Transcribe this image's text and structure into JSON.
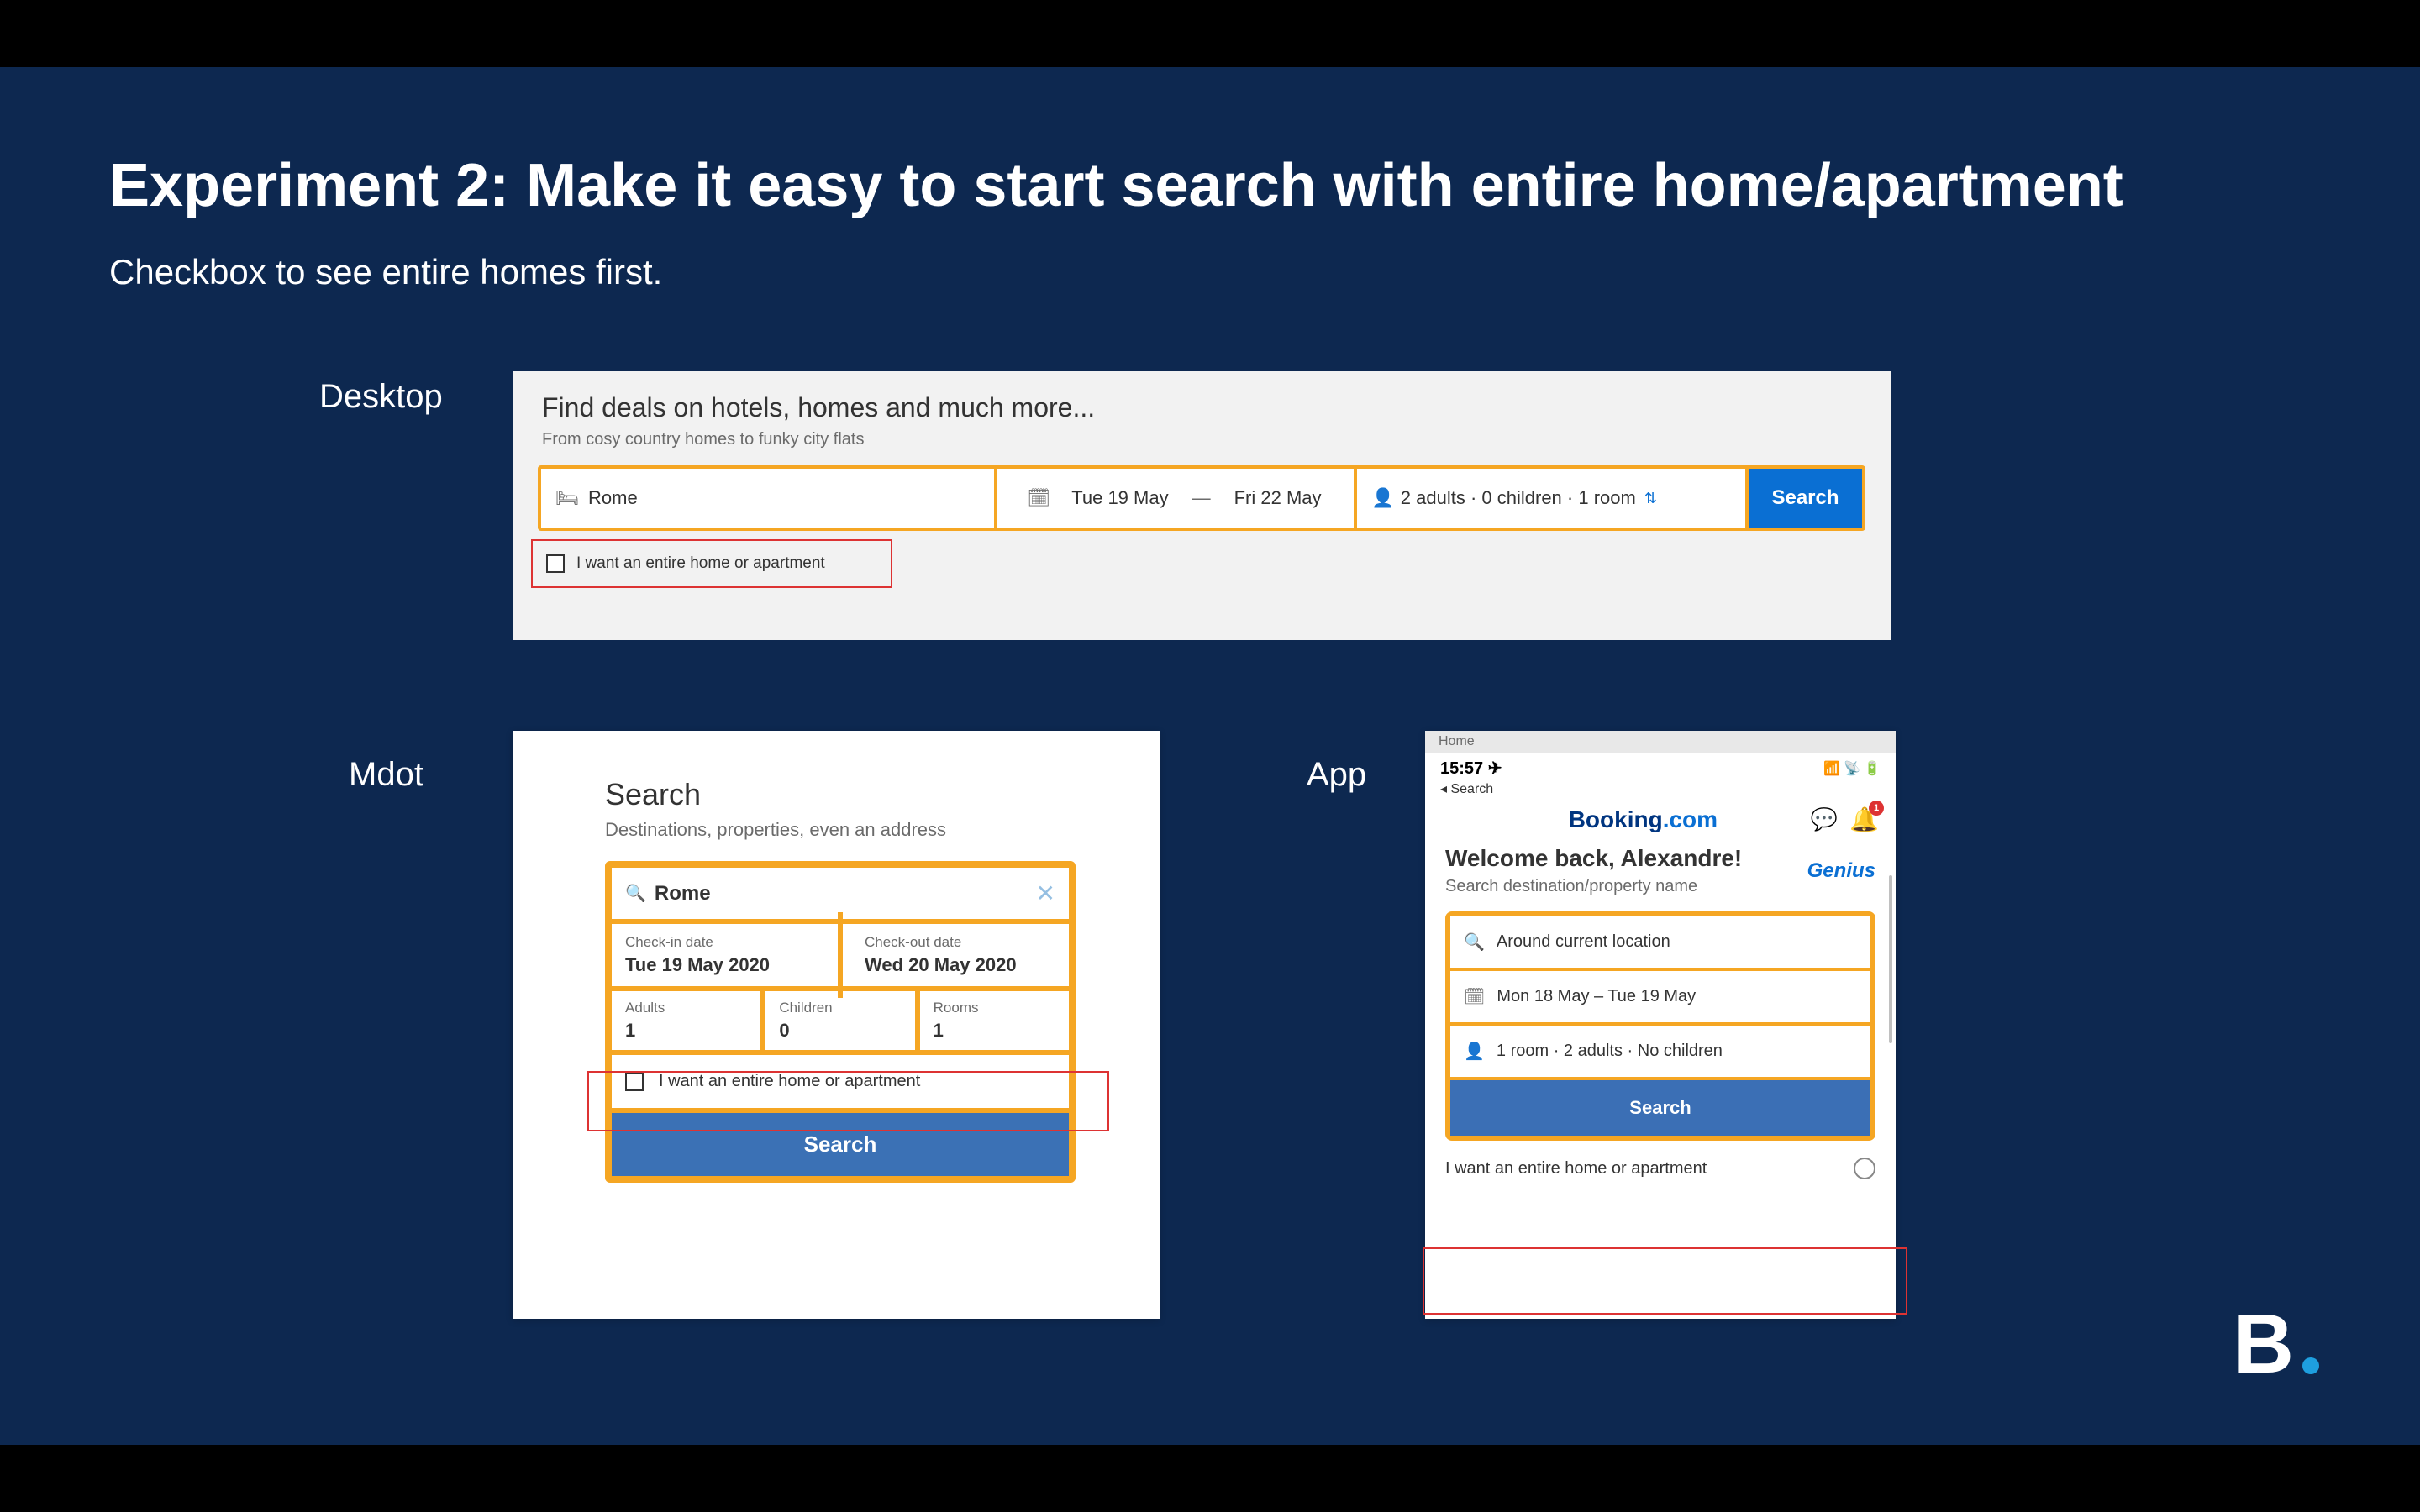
{
  "slide": {
    "title": "Experiment 2: Make it easy to start search with entire home/apartment",
    "subtitle": "Checkbox to see entire homes first.",
    "labels": {
      "desktop": "Desktop",
      "mdot": "Mdot",
      "app": "App"
    }
  },
  "desktop": {
    "headline": "Find deals on hotels, homes and much more...",
    "sub": "From cosy country homes to funky city flats",
    "destination": "Rome",
    "date_start": "Tue 19 May",
    "date_end": "Fri 22 May",
    "guests": "2 adults  ·  0 children  ·  1 room",
    "search_label": "Search",
    "checkbox_label": "I want an entire home or apartment"
  },
  "mdot": {
    "title": "Search",
    "sub": "Destinations, properties, even an address",
    "destination": "Rome",
    "checkin_label": "Check-in date",
    "checkin_value": "Tue 19 May 2020",
    "checkout_label": "Check-out date",
    "checkout_value": "Wed 20 May 2020",
    "adults_label": "Adults",
    "adults_value": "1",
    "children_label": "Children",
    "children_value": "0",
    "rooms_label": "Rooms",
    "rooms_value": "1",
    "checkbox_label": "I want an entire home or apartment",
    "search_label": "Search"
  },
  "app": {
    "tab_label": "Home",
    "time": "15:57",
    "back": "◂ Search",
    "logo_main": "Booking",
    "logo_com": ".com",
    "badge_count": "1",
    "welcome": "Welcome back, Alexandre!",
    "welcome_sub": "Search destination/property name",
    "genius": "Genius",
    "location": "Around current location",
    "dates": "Mon 18 May  –  Tue 19 May",
    "guests": "1 room · 2 adults · No children",
    "search_label": "Search",
    "checkbox_label": "I want an entire home or apartment"
  }
}
